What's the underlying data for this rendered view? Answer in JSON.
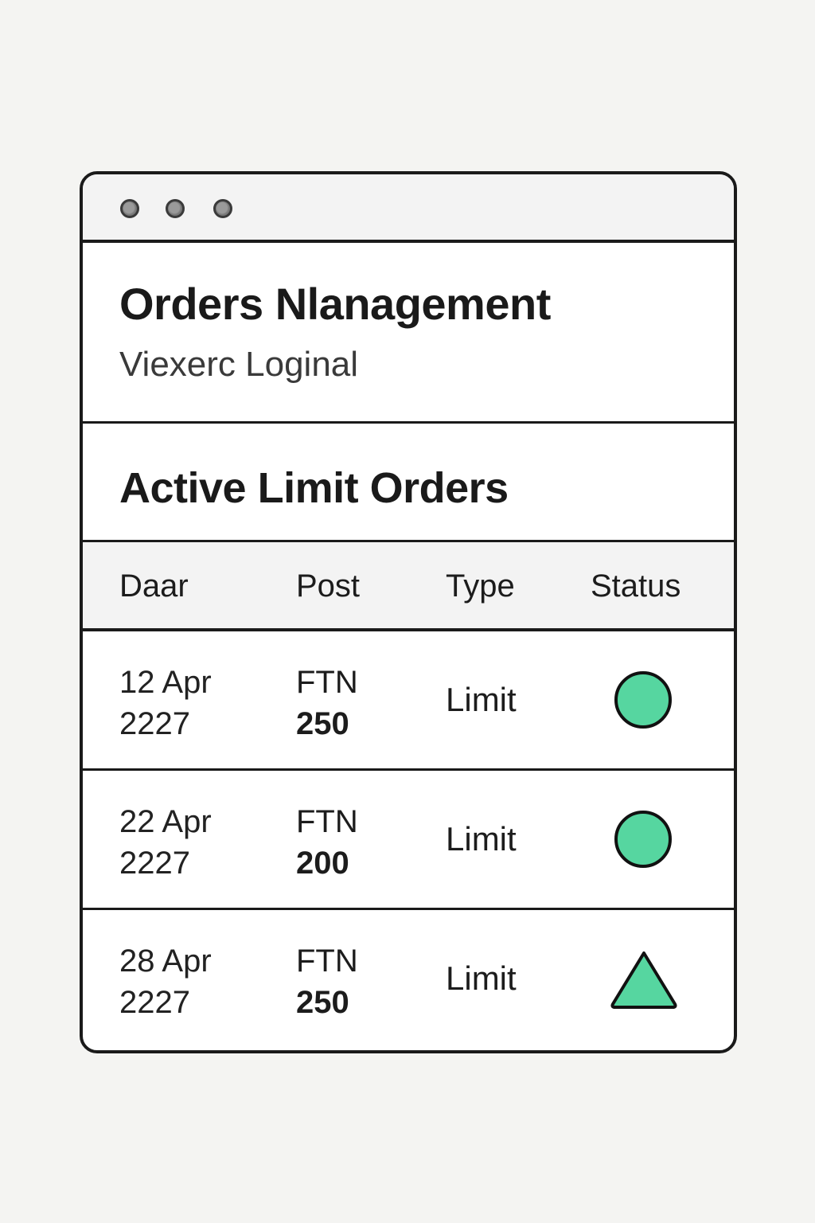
{
  "window": {
    "controls": [
      "window-dot",
      "window-dot",
      "window-dot"
    ]
  },
  "header": {
    "title": "Orders Nlanagement",
    "subtitle": "Viexerc Loginal"
  },
  "section": {
    "title": "Active Limit Orders"
  },
  "table": {
    "columns": [
      "Daar",
      "Post",
      "Type",
      "Status"
    ],
    "rows": [
      {
        "date_line1": "12 Apr",
        "date_line2": "2227",
        "symbol": "FTN",
        "quantity": "250",
        "type": "Limit",
        "status_icon": "circle",
        "status_color": "#56d6a0"
      },
      {
        "date_line1": "22 Apr",
        "date_line2": "2227",
        "symbol": "FTN",
        "quantity": "200",
        "type": "Limit",
        "status_icon": "circle",
        "status_color": "#56d6a0"
      },
      {
        "date_line1": "28 Apr",
        "date_line2": "2227",
        "symbol": "FTN",
        "quantity": "250",
        "type": "Limit",
        "status_icon": "triangle",
        "status_color": "#56d6a0"
      }
    ]
  },
  "colors": {
    "background": "#f4f4f2",
    "window": "#ffffff",
    "border": "#1a1a1a",
    "header_band": "#f3f3f3",
    "status_green": "#56d6a0"
  }
}
